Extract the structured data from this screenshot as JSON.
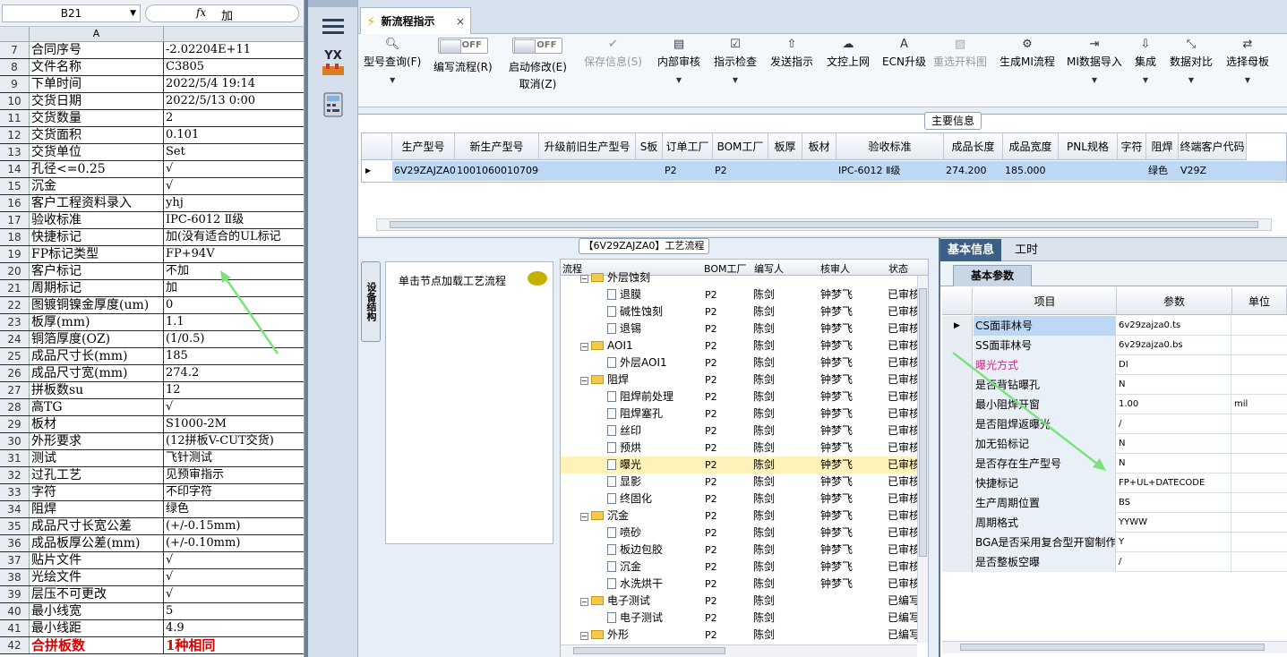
{
  "excel": {
    "namebox": "B21",
    "fx": "fx",
    "formula": "加",
    "col_a": "A",
    "rows": [
      {
        "n": "7",
        "a": "合同序号",
        "b": "-2.02204E+11"
      },
      {
        "n": "8",
        "a": "文件名称",
        "b": "C3805"
      },
      {
        "n": "9",
        "a": "下单时间",
        "b": "2022/5/4 19:14"
      },
      {
        "n": "10",
        "a": "交货日期",
        "b": "2022/5/13 0:00"
      },
      {
        "n": "11",
        "a": "交货数量",
        "b": "2"
      },
      {
        "n": "12",
        "a": "交货面积",
        "b": "0.101"
      },
      {
        "n": "13",
        "a": "交货单位",
        "b": "Set"
      },
      {
        "n": "14",
        "a": "孔径<=0.25",
        "b": "√"
      },
      {
        "n": "15",
        "a": "沉金",
        "b": "√"
      },
      {
        "n": "16",
        "a": "客户工程资料录入",
        "b": "yhj"
      },
      {
        "n": "17",
        "a": "验收标准",
        "b": "IPC-6012 Ⅱ级"
      },
      {
        "n": "18",
        "a": "快捷标记",
        "b": "加(没有适合的UL标记"
      },
      {
        "n": "19",
        "a": "FP标记类型",
        "b": "FP+94V"
      },
      {
        "n": "20",
        "a": "客户标记",
        "b": "不加"
      },
      {
        "n": "21",
        "a": "周期标记",
        "b": "加"
      },
      {
        "n": "22",
        "a": "图镀铜镍金厚度(um)",
        "b": "0"
      },
      {
        "n": "23",
        "a": "板厚(mm)",
        "b": "1.1"
      },
      {
        "n": "24",
        "a": "铜箔厚度(OZ)",
        "b": "(1/0.5)"
      },
      {
        "n": "25",
        "a": "成品尺寸长(mm)",
        "b": "185"
      },
      {
        "n": "26",
        "a": "成品尺寸宽(mm)",
        "b": "274.2"
      },
      {
        "n": "27",
        "a": "拼板数su",
        "b": "12"
      },
      {
        "n": "28",
        "a": "高TG",
        "b": "√"
      },
      {
        "n": "29",
        "a": "板材",
        "b": "S1000-2M"
      },
      {
        "n": "30",
        "a": "外形要求",
        "b": "(12拼板V-CUT交货)"
      },
      {
        "n": "31",
        "a": "测试",
        "b": "飞针测试"
      },
      {
        "n": "32",
        "a": "过孔工艺",
        "b": "见预审指示"
      },
      {
        "n": "33",
        "a": "字符",
        "b": "不印字符"
      },
      {
        "n": "34",
        "a": "阻焊",
        "b": "绿色"
      },
      {
        "n": "35",
        "a": "成品尺寸长宽公差",
        "b": "(+/-0.15mm)"
      },
      {
        "n": "36",
        "a": "成品板厚公差(mm)",
        "b": "(+/-0.10mm)"
      },
      {
        "n": "37",
        "a": "贴片文件",
        "b": "√"
      },
      {
        "n": "38",
        "a": "光绘文件",
        "b": "√"
      },
      {
        "n": "39",
        "a": "层压不可更改",
        "b": "√"
      },
      {
        "n": "40",
        "a": "最小线宽",
        "b": "5"
      },
      {
        "n": "41",
        "a": "最小线距",
        "b": "4.9"
      },
      {
        "n": "42",
        "a": "合拼板数",
        "b": "1种相同",
        "red": true
      }
    ]
  },
  "sidebar": {
    "yx_label": "YX"
  },
  "tab": {
    "title": "新流程指示",
    "close": "×"
  },
  "toolbar": {
    "query": "型号查询(F)",
    "edit_flow": "编写流程(R)",
    "toggle_off": "OFF",
    "start_modify": "启动修改(E)",
    "cancel": "取消(Z)",
    "save_info": "保存信息(S)",
    "internal_review": "内部审核",
    "directive_check": "指示检查",
    "send_directive": "发送指示",
    "upload": "文控上网",
    "ecn": "ECN升级",
    "reselect": "重选开料图",
    "gen_mi": "生成MI流程",
    "mi_import": "MI数据导入",
    "integrate": "集成",
    "compare": "数据对比",
    "choose_master": "选择母板"
  },
  "main_info": {
    "title": "主要信息",
    "columns": [
      "生产型号",
      "新生产型号",
      "升级前旧生产型号",
      "S板",
      "订单工厂",
      "BOM工厂",
      "板厚",
      "板材",
      "验收标准",
      "成品长度",
      "成品宽度",
      "PNL规格",
      "字符",
      "阻焊",
      "终端客户代码"
    ],
    "row": [
      "6V29ZAJZA0",
      "10010600107096",
      "",
      "",
      "P2",
      "P2",
      "",
      "",
      "IPC-6012 Ⅱ级",
      "274.200",
      "185.000",
      "",
      "",
      "绿色",
      "V29Z"
    ]
  },
  "process": {
    "title": "【6V29ZAJZA0】工艺流程",
    "side_tab": "设备结构",
    "load_hint": "单击节点加载工艺流程",
    "columns": [
      "流程",
      "BOM工厂",
      "编写人",
      "核审人",
      "状态"
    ],
    "rows": [
      {
        "name": "外层蚀刻",
        "lvl": 1,
        "type": "folder",
        "f": "",
        "w": "",
        "r": "",
        "s": ""
      },
      {
        "name": "退膜",
        "lvl": 2,
        "type": "doc",
        "f": "P2",
        "w": "陈剑",
        "r": "钟梦飞",
        "s": "已审核"
      },
      {
        "name": "碱性蚀刻",
        "lvl": 2,
        "type": "doc",
        "f": "P2",
        "w": "陈剑",
        "r": "钟梦飞",
        "s": "已审核"
      },
      {
        "name": "退锡",
        "lvl": 2,
        "type": "doc",
        "f": "P2",
        "w": "陈剑",
        "r": "钟梦飞",
        "s": "已审核"
      },
      {
        "name": "AOI1",
        "lvl": 1,
        "type": "folder",
        "f": "P2",
        "w": "陈剑",
        "r": "钟梦飞",
        "s": "已审核"
      },
      {
        "name": "外层AOI1",
        "lvl": 2,
        "type": "doc",
        "f": "P2",
        "w": "陈剑",
        "r": "钟梦飞",
        "s": "已审核"
      },
      {
        "name": "阻焊",
        "lvl": 1,
        "type": "folder",
        "f": "P2",
        "w": "陈剑",
        "r": "钟梦飞",
        "s": "已审核"
      },
      {
        "name": "阻焊前处理",
        "lvl": 2,
        "type": "doc",
        "f": "P2",
        "w": "陈剑",
        "r": "钟梦飞",
        "s": "已审核"
      },
      {
        "name": "阻焊塞孔",
        "lvl": 2,
        "type": "doc",
        "f": "P2",
        "w": "陈剑",
        "r": "钟梦飞",
        "s": "已审核"
      },
      {
        "name": "丝印",
        "lvl": 2,
        "type": "doc",
        "f": "P2",
        "w": "陈剑",
        "r": "钟梦飞",
        "s": "已审核"
      },
      {
        "name": "预烘",
        "lvl": 2,
        "type": "doc",
        "f": "P2",
        "w": "陈剑",
        "r": "钟梦飞",
        "s": "已审核"
      },
      {
        "name": "曝光",
        "lvl": 2,
        "type": "doc",
        "f": "P2",
        "w": "陈剑",
        "r": "钟梦飞",
        "s": "已审核",
        "sel": true
      },
      {
        "name": "显影",
        "lvl": 2,
        "type": "doc",
        "f": "P2",
        "w": "陈剑",
        "r": "钟梦飞",
        "s": "已审核"
      },
      {
        "name": "终固化",
        "lvl": 2,
        "type": "doc",
        "f": "P2",
        "w": "陈剑",
        "r": "钟梦飞",
        "s": "已审核"
      },
      {
        "name": "沉金",
        "lvl": 1,
        "type": "folder",
        "f": "P2",
        "w": "陈剑",
        "r": "钟梦飞",
        "s": "已审核"
      },
      {
        "name": "喷砂",
        "lvl": 2,
        "type": "doc",
        "f": "P2",
        "w": "陈剑",
        "r": "钟梦飞",
        "s": "已审核"
      },
      {
        "name": "板边包胶",
        "lvl": 2,
        "type": "doc",
        "f": "P2",
        "w": "陈剑",
        "r": "钟梦飞",
        "s": "已审核"
      },
      {
        "name": "沉金",
        "lvl": 2,
        "type": "doc",
        "f": "P2",
        "w": "陈剑",
        "r": "钟梦飞",
        "s": "已审核"
      },
      {
        "name": "水洗烘干",
        "lvl": 2,
        "type": "doc",
        "f": "P2",
        "w": "陈剑",
        "r": "钟梦飞",
        "s": "已审核"
      },
      {
        "name": "电子测试",
        "lvl": 1,
        "type": "folder",
        "f": "P2",
        "w": "陈剑",
        "r": "",
        "s": "已编写"
      },
      {
        "name": "电子测试",
        "lvl": 2,
        "type": "doc",
        "f": "P2",
        "w": "陈剑",
        "r": "",
        "s": "已编写"
      },
      {
        "name": "外形",
        "lvl": 1,
        "type": "folder",
        "f": "P2",
        "w": "陈剑",
        "r": "",
        "s": "已编写"
      }
    ]
  },
  "basic": {
    "tabs": [
      "基本信息",
      "工时"
    ],
    "subtab": "基本参数",
    "columns": [
      "项目",
      "参数",
      "单位"
    ],
    "rows": [
      {
        "k": "CS面菲林号",
        "v": "6v29zajza0.ts",
        "u": ""
      },
      {
        "k": "SS面菲林号",
        "v": "6v29zajza0.bs",
        "u": ""
      },
      {
        "k": "曝光方式",
        "v": "DI",
        "u": "",
        "pink": true
      },
      {
        "k": "是否背钻曝孔",
        "v": "N",
        "u": ""
      },
      {
        "k": "最小阻焊开窗",
        "v": "1.00",
        "u": "mil"
      },
      {
        "k": "是否阻焊返曝光",
        "v": "/",
        "u": ""
      },
      {
        "k": "加无铅标记",
        "v": "N",
        "u": ""
      },
      {
        "k": "是否存在生产型号",
        "v": "N",
        "u": ""
      },
      {
        "k": "快捷标记",
        "v": "FP+UL+DATECODE",
        "u": ""
      },
      {
        "k": "生产周期位置",
        "v": "BS",
        "u": ""
      },
      {
        "k": "周期格式",
        "v": "YYWW",
        "u": ""
      },
      {
        "k": "BGA是否采用复合型开窗制作",
        "v": "Y",
        "u": ""
      },
      {
        "k": "是否整板空曝",
        "v": "/",
        "u": ""
      }
    ]
  }
}
